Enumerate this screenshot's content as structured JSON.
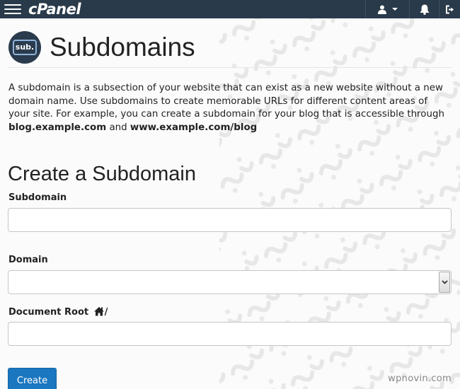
{
  "app": {
    "brand": "cPanel"
  },
  "header": {
    "title": "Subdomains",
    "icon_label": "sub."
  },
  "description": {
    "text": "A subdomain is a subsection of your website that can exist as a new website without a new domain name. Use subdomains to create memorable URLs for different content areas of your site. For example, you can create a subdomain for your blog that is accessible through ",
    "example1": "blog.example.com",
    "connector": " and ",
    "example2": "www.example.com/blog"
  },
  "form": {
    "title": "Create a Subdomain",
    "subdomain": {
      "label": "Subdomain",
      "value": "",
      "placeholder": ""
    },
    "domain": {
      "label": "Domain",
      "selected": ""
    },
    "document_root": {
      "label": "Document Root",
      "suffix": "/",
      "value": "",
      "placeholder": ""
    },
    "submit_label": "Create"
  },
  "footer": {
    "brand": "wpnovin.com"
  },
  "icons": {
    "menu": "hamburger-icon",
    "user": "user-icon",
    "notifications": "bell-icon",
    "logout": "logout-icon",
    "home": "home-icon",
    "dropdown": "chevron-down-icon"
  },
  "colors": {
    "topbar": "#293a4a",
    "primary_button": "#1b77c0",
    "header_icon_bg": "#2a3b4d"
  }
}
